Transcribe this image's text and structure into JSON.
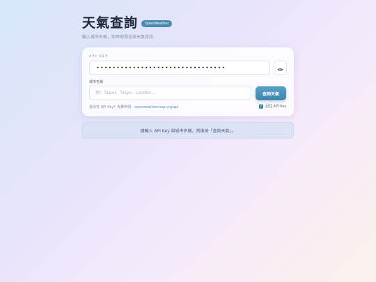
{
  "header": {
    "title": "天氣查詢",
    "badge": "OpenWeather",
    "subtitle": "輸入城市名稱，即時取得全球天氣資訊"
  },
  "form": {
    "api_label": "API KEY",
    "api_value": "••••••••••••••••••••••••••••••••",
    "city_label": "城市名稱",
    "city_placeholder": "例：Taipei、Tokyo、London …",
    "query_button": "查詢天氣",
    "hint_prefix": "還沒有 API Key？免費申請：",
    "hint_link": "openweathermap.org/api",
    "remember_label": "記住 API Key",
    "remember_checked": true
  },
  "notice": {
    "text": "請輸入 API Key 與城市名稱，然後按「查詢天氣」。"
  },
  "icons": {
    "toggle_visibility": "eye-icon",
    "checkbox": "check-icon"
  },
  "colors": {
    "accent": "#3f85ad",
    "badge": "#4a8ab0",
    "link": "#5a95c0"
  }
}
